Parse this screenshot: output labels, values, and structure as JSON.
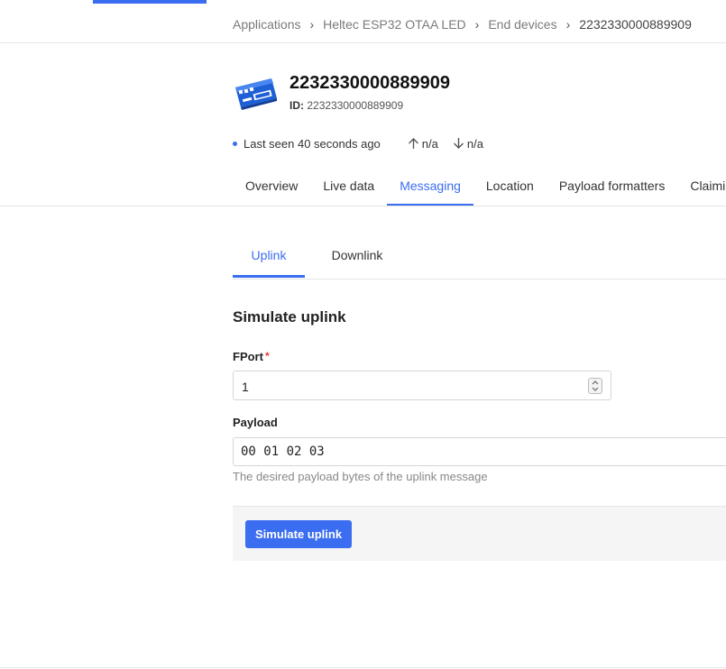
{
  "breadcrumb": {
    "items": [
      "Applications",
      "Heltec ESP32 OTAA LED",
      "End devices",
      "2232330000889909"
    ]
  },
  "device": {
    "title": "2232330000889909",
    "id_label": "ID:",
    "id_value": "2232330000889909",
    "icon": "device-board-icon"
  },
  "status": {
    "last_seen": "Last seen 40 seconds ago",
    "uplink": "n/a",
    "downlink": "n/a",
    "dot_color": "#3b6df0"
  },
  "tabs": [
    "Overview",
    "Live data",
    "Messaging",
    "Location",
    "Payload formatters",
    "Claiming"
  ],
  "active_tab": "Messaging",
  "subtabs": [
    "Uplink",
    "Downlink"
  ],
  "active_subtab": "Uplink",
  "form": {
    "section_title": "Simulate uplink",
    "fport_label": "FPort",
    "fport_required": "*",
    "fport_value": "1",
    "payload_label": "Payload",
    "payload_value": "00 01 02 03",
    "payload_help": "The desired payload bytes of the uplink message",
    "submit_label": "Simulate uplink"
  },
  "colors": {
    "accent": "#3b6df0",
    "required": "#e33333"
  }
}
